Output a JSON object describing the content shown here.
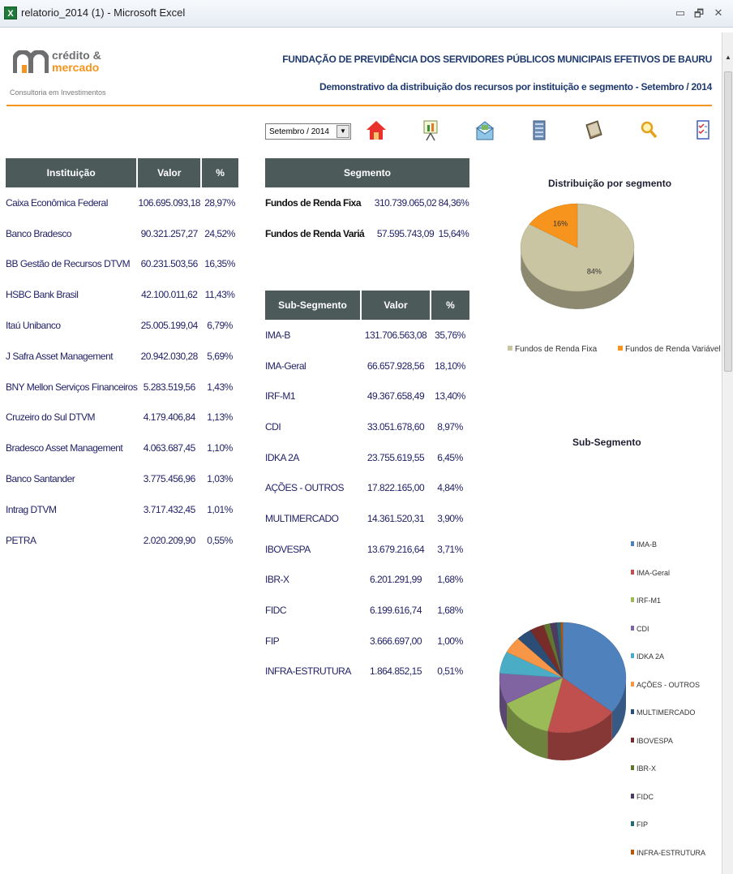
{
  "window": {
    "title": "relatorio_2014 (1) - Microsoft Excel",
    "minimize": "▭",
    "restore": "🗗",
    "close": "✕"
  },
  "logo": {
    "line1": "crédito &",
    "line2": "mercado",
    "tagline": "Consultoria em Investimentos"
  },
  "header": {
    "org": "FUNDAÇÃO DE PREVIDÊNCIA DOS SERVIDORES PÚBLICOS MUNICIPAIS EFETIVOS DE BAURU",
    "subtitle": "Demonstrativo da distribuição dos recursos por instituição e segmento  -  Setembro / 2014"
  },
  "period_select": {
    "value": "Setembro / 2014"
  },
  "toolbar_icons": [
    "home-icon",
    "presentation-icon",
    "envelope-icon",
    "database-icon",
    "book-icon",
    "magnifier-icon",
    "checklist-icon"
  ],
  "institutions": {
    "headers": [
      "Instituição",
      "Valor",
      "%"
    ],
    "rows": [
      [
        "Caixa Econômica Federal",
        "106.695.093,18",
        "28,97%"
      ],
      [
        "Banco Bradesco",
        "90.321.257,27",
        "24,52%"
      ],
      [
        "BB Gestão de Recursos DTVM",
        "60.231.503,56",
        "16,35%"
      ],
      [
        "HSBC Bank Brasil",
        "42.100.011,62",
        "11,43%"
      ],
      [
        "Itaú Unibanco",
        "25.005.199,04",
        "6,79%"
      ],
      [
        "J Safra Asset Management",
        "20.942.030,28",
        "5,69%"
      ],
      [
        "BNY Mellon Serviços Financeiros",
        "5.283.519,56",
        "1,43%"
      ],
      [
        "Cruzeiro do Sul DTVM",
        "4.179.406,84",
        "1,13%"
      ],
      [
        "Bradesco Asset Management",
        "4.063.687,45",
        "1,10%"
      ],
      [
        "Banco Santander",
        "3.775.456,96",
        "1,03%"
      ],
      [
        "Intrag DTVM",
        "3.717.432,45",
        "1,01%"
      ],
      [
        "PETRA",
        "2.020.209,90",
        "0,55%"
      ]
    ]
  },
  "segments": {
    "header": "Segmento",
    "rows": [
      [
        "Fundos de Renda Fixa",
        "310.739.065,02",
        "84,36%"
      ],
      [
        "Fundos de Renda Variá",
        "57.595.743,09",
        "15,64%"
      ]
    ]
  },
  "subsegments": {
    "headers": [
      "Sub-Segmento",
      "Valor",
      "%"
    ],
    "rows": [
      [
        "IMA-B",
        "131.706.563,08",
        "35,76%"
      ],
      [
        "IMA-Geral",
        "66.657.928,56",
        "18,10%"
      ],
      [
        "IRF-M1",
        "49.367.658,49",
        "13,40%"
      ],
      [
        "CDI",
        "33.051.678,60",
        "8,97%"
      ],
      [
        "IDKA 2A",
        "23.755.619,55",
        "6,45%"
      ],
      [
        "AÇÕES - OUTROS",
        "17.822.165,00",
        "4,84%"
      ],
      [
        "MULTIMERCADO",
        "14.361.520,31",
        "3,90%"
      ],
      [
        "IBOVESPA",
        "13.679.216,64",
        "3,71%"
      ],
      [
        "IBR-X",
        "6.201.291,99",
        "1,68%"
      ],
      [
        "FIDC",
        "6.199.616,74",
        "1,68%"
      ],
      [
        "FIP",
        "3.666.697,00",
        "1,00%"
      ],
      [
        "INFRA-ESTRUTURA",
        "1.864.852,15",
        "0,51%"
      ]
    ]
  },
  "chart_data": [
    {
      "type": "pie",
      "title": "Distribuição por segmento",
      "categories": [
        "Fundos de Renda Fixa",
        "Fundos de Renda Variável"
      ],
      "values": [
        84,
        16
      ],
      "data_labels": [
        "84%",
        "16%"
      ],
      "colors": [
        "#c9c4a2",
        "#f7941d"
      ],
      "legend": "bottom"
    },
    {
      "type": "pie",
      "title": "Sub-Segmento",
      "categories": [
        "IMA-B",
        "IMA-Geral",
        "IRF-M1",
        "CDI",
        "IDKA 2A",
        "AÇÕES - OUTROS",
        "MULTIMERCADO",
        "IBOVESPA",
        "IBR-X",
        "FIDC",
        "FIP",
        "INFRA-ESTRUTURA"
      ],
      "values": [
        35.76,
        18.1,
        13.4,
        8.97,
        6.45,
        4.84,
        3.9,
        3.71,
        1.68,
        1.68,
        1.0,
        0.51
      ],
      "legend_labels": [
        "IMA-B",
        "IMA-Geral",
        "IRF-M1",
        "CDI",
        "IDKA 2A",
        "AÇÕES - OUTROS",
        "MULTIMERCADO",
        "IBOVESPA",
        "IBR-X",
        "FIDC",
        "FIP",
        "INFRA-ESTRUTURA"
      ],
      "colors": [
        "#4f81bd",
        "#c0504d",
        "#9bbb59",
        "#8064a2",
        "#4bacc6",
        "#f79646",
        "#2c4d75",
        "#772c2a",
        "#5f7530",
        "#4d3b62",
        "#276a7c",
        "#b65708"
      ],
      "legend": "right"
    }
  ]
}
